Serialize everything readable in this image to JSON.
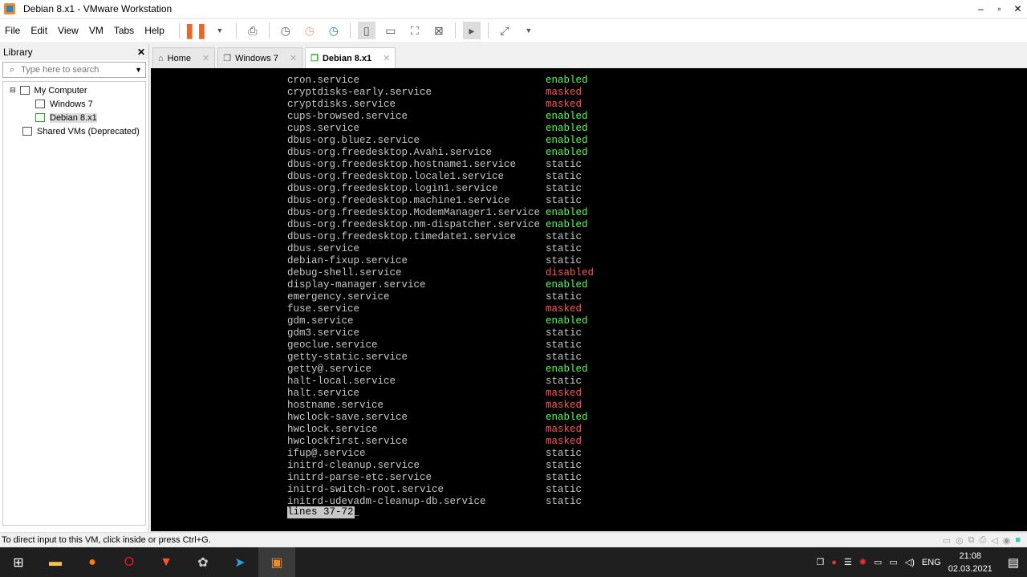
{
  "window": {
    "title": "Debian 8.x1 - VMware Workstation",
    "min": "–",
    "max": "▫",
    "close": "✕"
  },
  "menu": [
    "File",
    "Edit",
    "View",
    "VM",
    "Tabs",
    "Help"
  ],
  "library": {
    "title": "Library",
    "close": "✕",
    "search_placeholder": "Type here to search",
    "tree": [
      {
        "label": "My Computer",
        "level": 0
      },
      {
        "label": "Windows 7",
        "level": 1
      },
      {
        "label": "Debian 8.x1",
        "level": 1,
        "selected": true
      },
      {
        "label": "Shared VMs (Deprecated)",
        "level": 0
      }
    ]
  },
  "tabs": [
    {
      "label": "Home",
      "icon": "⌂"
    },
    {
      "label": "Windows 7",
      "icon": "❐"
    },
    {
      "label": "Debian 8.x1",
      "icon": "❐",
      "active": true
    }
  ],
  "colors": {
    "enabled": "#55ff55",
    "masked": "#ff5555",
    "disabled": "#ff5555",
    "static": "#c8c8c8"
  },
  "terminal": {
    "rows": [
      [
        "cron.service",
        "enabled"
      ],
      [
        "cryptdisks-early.service",
        "masked"
      ],
      [
        "cryptdisks.service",
        "masked"
      ],
      [
        "cups-browsed.service",
        "enabled"
      ],
      [
        "cups.service",
        "enabled"
      ],
      [
        "dbus-org.bluez.service",
        "enabled"
      ],
      [
        "dbus-org.freedesktop.Avahi.service",
        "enabled"
      ],
      [
        "dbus-org.freedesktop.hostname1.service",
        "static"
      ],
      [
        "dbus-org.freedesktop.locale1.service",
        "static"
      ],
      [
        "dbus-org.freedesktop.login1.service",
        "static"
      ],
      [
        "dbus-org.freedesktop.machine1.service",
        "static"
      ],
      [
        "dbus-org.freedesktop.ModemManager1.service",
        "enabled"
      ],
      [
        "dbus-org.freedesktop.nm-dispatcher.service",
        "enabled"
      ],
      [
        "dbus-org.freedesktop.timedate1.service",
        "static"
      ],
      [
        "dbus.service",
        "static"
      ],
      [
        "debian-fixup.service",
        "static"
      ],
      [
        "debug-shell.service",
        "disabled"
      ],
      [
        "display-manager.service",
        "enabled"
      ],
      [
        "emergency.service",
        "static"
      ],
      [
        "fuse.service",
        "masked"
      ],
      [
        "gdm.service",
        "enabled"
      ],
      [
        "gdm3.service",
        "static"
      ],
      [
        "geoclue.service",
        "static"
      ],
      [
        "getty-static.service",
        "static"
      ],
      [
        "getty@.service",
        "enabled"
      ],
      [
        "halt-local.service",
        "static"
      ],
      [
        "halt.service",
        "masked"
      ],
      [
        "hostname.service",
        "masked"
      ],
      [
        "hwclock-save.service",
        "enabled"
      ],
      [
        "hwclock.service",
        "masked"
      ],
      [
        "hwclockfirst.service",
        "masked"
      ],
      [
        "ifup@.service",
        "static"
      ],
      [
        "initrd-cleanup.service",
        "static"
      ],
      [
        "initrd-parse-etc.service",
        "static"
      ],
      [
        "initrd-switch-root.service",
        "static"
      ],
      [
        "initrd-udevadm-cleanup-db.service",
        "static"
      ]
    ],
    "pager": "lines 37-72",
    "cursor": "_"
  },
  "status": {
    "text": "To direct input to this VM, click inside or press Ctrl+G."
  },
  "tray": {
    "lang": "ENG",
    "time": "21:08",
    "date": "02.03.2021"
  }
}
